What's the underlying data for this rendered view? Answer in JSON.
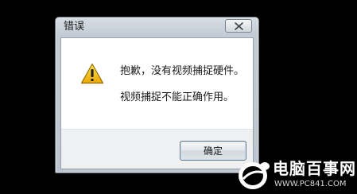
{
  "dialog": {
    "title": "错误",
    "message_line1": "抱歉，没有视频捕捉硬件。",
    "message_line2": "视频捕捉不能正确作用。",
    "ok_label": "确定",
    "close_icon": "close-icon",
    "warning_icon": "warning-icon"
  },
  "watermark": {
    "title": "电脑百事网",
    "url": "WWW.PC841.COM"
  },
  "colors": {
    "background": "#000000",
    "title_bar": "#c3cbd4",
    "warning_yellow": "#f5c400",
    "footer": "#eef0f2"
  }
}
